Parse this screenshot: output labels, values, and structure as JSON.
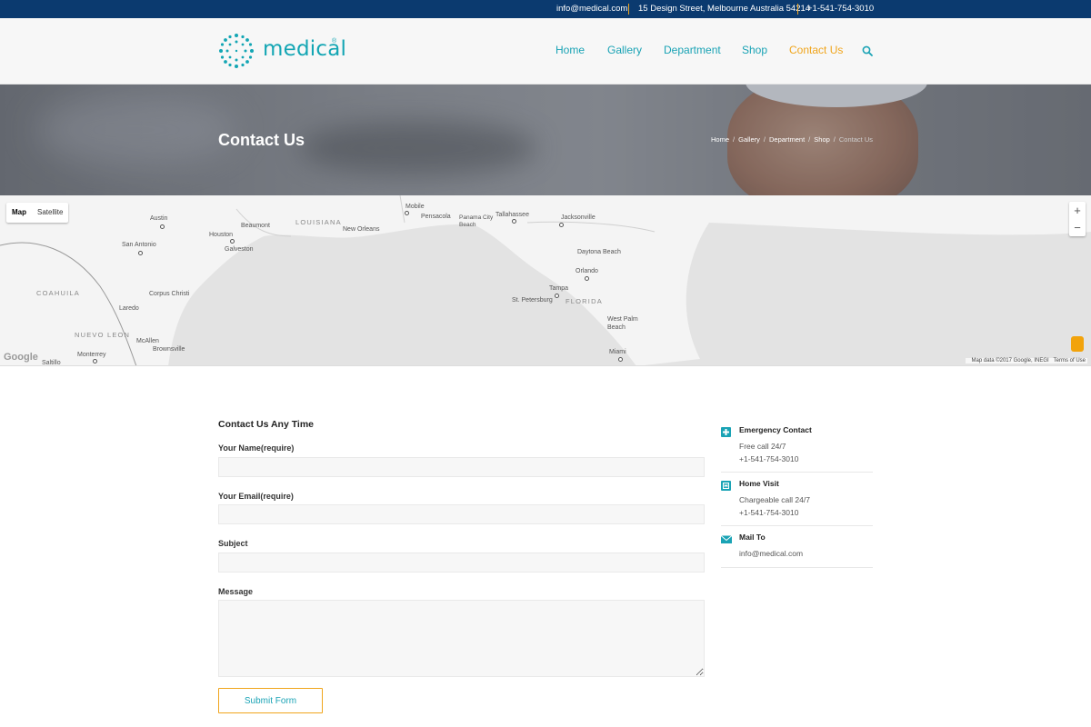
{
  "topbar": {
    "email": "info@medical.com",
    "address": "15 Design Street, Melbourne Australia 54214",
    "phone": "+1-541-754-3010"
  },
  "header": {
    "logo_text": "medical",
    "logo_mark": "®",
    "nav": [
      {
        "label": "Home"
      },
      {
        "label": "Gallery"
      },
      {
        "label": "Department"
      },
      {
        "label": "Shop"
      },
      {
        "label": "Contact Us",
        "active": true
      }
    ],
    "search_icon": "search-icon"
  },
  "hero": {
    "title": "Contact Us",
    "breadcrumb": [
      "Home",
      "Gallery",
      "Department",
      "Shop",
      "Contact Us"
    ],
    "separator": "/"
  },
  "map": {
    "type_options": [
      "Map",
      "Satellite"
    ],
    "selected_type": "Map",
    "zoom_in": "+",
    "zoom_out": "−",
    "states": [
      "LOUISIANA",
      "FLORIDA",
      "COAHUILA",
      "NUEVO LEON"
    ],
    "cities": [
      "Austin",
      "Beaumont",
      "Houston",
      "Galveston",
      "San Antonio",
      "Corpus Christi",
      "Laredo",
      "McAllen",
      "Brownsville",
      "Monterrey",
      "Saltillo",
      "New Orleans",
      "Mobile",
      "Pensacola",
      "Panama City Beach",
      "Tallahassee",
      "Jacksonville",
      "Daytona Beach",
      "Orlando",
      "Tampa",
      "St. Petersburg",
      "West Palm Beach",
      "Miami"
    ],
    "google": "Google",
    "attribution": "Map data ©2017 Google, INEGI",
    "terms": "Terms of Use",
    "colors": {
      "land": "#f4f4f4",
      "water": "#e3e3e3"
    }
  },
  "form": {
    "title": "Contact Us Any Time",
    "name_label": "Your Name(require)",
    "email_label": "Your Email(require)",
    "subject_label": "Subject",
    "message_label": "Message",
    "name_value": "",
    "email_value": "",
    "subject_value": "",
    "message_value": "",
    "submit_label": "Submit Form"
  },
  "contact_info": [
    {
      "icon": "plus-icon",
      "title": "Emergency Contact",
      "line1": "Free call 24/7",
      "line2": "+1-541-754-3010"
    },
    {
      "icon": "hospital-icon",
      "title": "Home Visit",
      "line1": "Chargeable call 24/7",
      "line2": "+1-541-754-3010"
    },
    {
      "icon": "envelope-icon",
      "title": "Mail To",
      "line1": "info@medical.com"
    }
  ],
  "colors": {
    "topbar": "#0b3a6f",
    "accent": "#1aa3b5",
    "active": "#f0a51c"
  }
}
